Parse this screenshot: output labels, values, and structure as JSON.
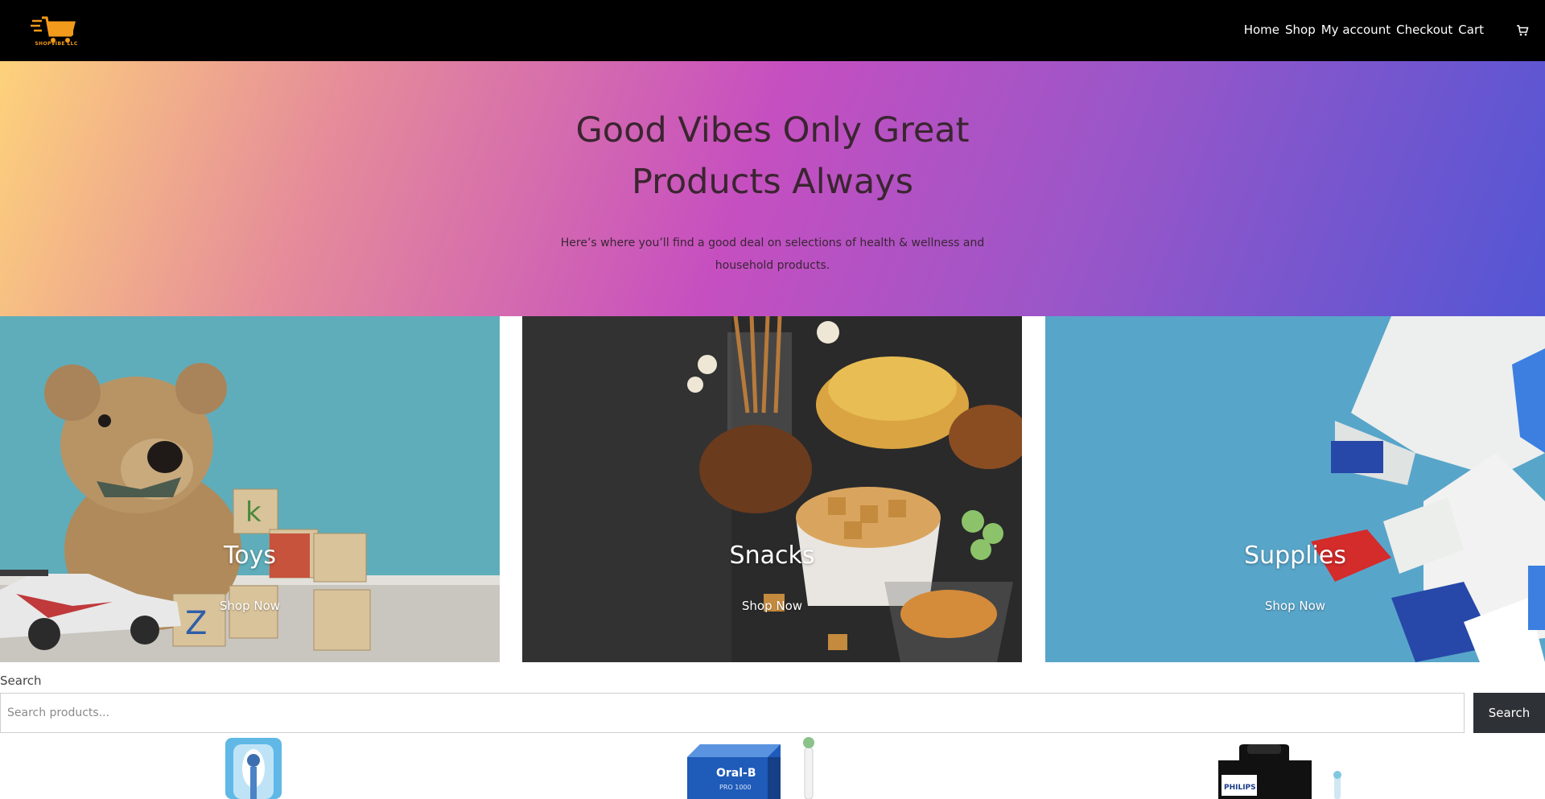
{
  "header": {
    "logo_text": "SHOPVIBE LLC",
    "nav": [
      {
        "label": "Home"
      },
      {
        "label": "Shop"
      },
      {
        "label": "My account"
      },
      {
        "label": "Checkout"
      },
      {
        "label": "Cart"
      }
    ],
    "cart_icon": "shopping-cart-icon"
  },
  "hero": {
    "title": "Good Vibes Only Great Products Always",
    "subtitle": "Here’s where you’ll find a good deal on selections of health & wellness and household products."
  },
  "categories": [
    {
      "title": "Toys",
      "link": "Shop Now"
    },
    {
      "title": "Snacks",
      "link": "Shop Now"
    },
    {
      "title": "Supplies",
      "link": "Shop Now"
    }
  ],
  "search": {
    "label": "Search",
    "placeholder": "Search products...",
    "button_label": "Search"
  },
  "products": [
    {
      "brand": ""
    },
    {
      "brand": "Oral-B",
      "model": "PRO 1000"
    },
    {
      "brand": "PHILIPS"
    }
  ],
  "colors": {
    "header_bg": "#000000",
    "logo_orange": "#f29a1b",
    "search_button_bg": "#2e3237"
  }
}
